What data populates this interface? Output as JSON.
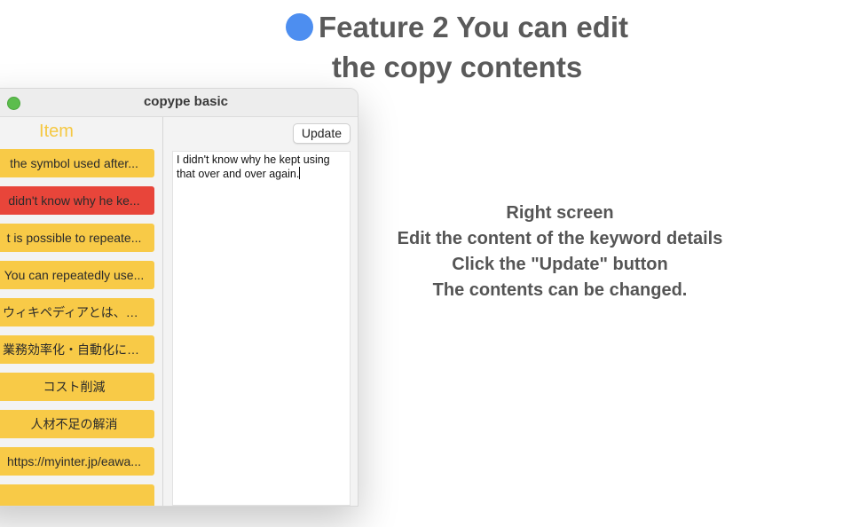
{
  "heading": {
    "line1": "Feature 2 You can edit",
    "line2": "the copy contents"
  },
  "window": {
    "title": "copype basic",
    "left_pane": {
      "header": "Item",
      "items": [
        {
          "label": "the symbol used after..."
        },
        {
          "label": "didn't know why he ke...",
          "selected": true
        },
        {
          "label": "t is possible to repeate..."
        },
        {
          "label": "You can repeatedly use..."
        },
        {
          "label": "ウィキペディアとは、世…"
        },
        {
          "label": "業務効率化・自動化によ…"
        },
        {
          "label": "コスト削減"
        },
        {
          "label": "人材不足の解消"
        },
        {
          "label": "https://myinter.jp/eawa..."
        },
        {
          "label": ""
        }
      ]
    },
    "right_pane": {
      "update_label": "Update",
      "editor_text": "I didn't know why he kept using\nthat over and over again."
    }
  },
  "description": {
    "lines": [
      "Right screen",
      "Edit the content of the keyword details",
      "Click the \"Update\" button",
      "The contents can be changed."
    ]
  },
  "colors": {
    "item_bg": "#f8ca47",
    "item_selected_bg": "#e8453a",
    "header_text": "#f5c842",
    "bullet": "#4d8ef0",
    "traffic_green": "#5cbd4d"
  }
}
